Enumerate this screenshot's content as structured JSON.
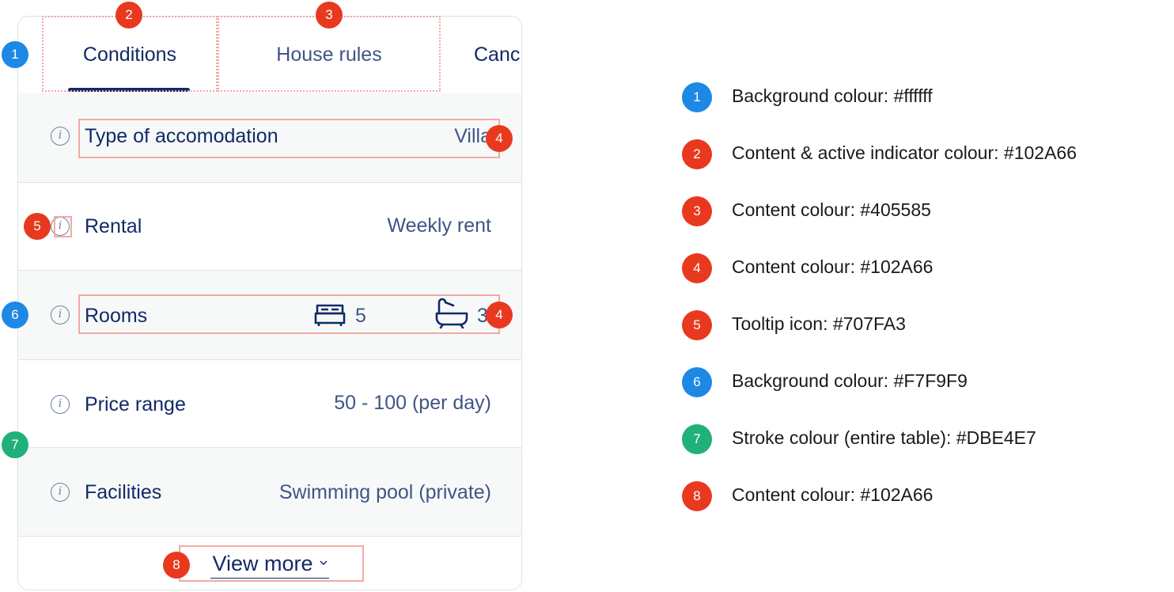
{
  "colors": {
    "blue": "#1E88E5",
    "red": "#E8391F",
    "green": "#20B07A",
    "content_dark": "#102A66",
    "content_mid": "#405585",
    "tooltip_icon": "#707FA3",
    "row_bg": "#F7F9F9",
    "stroke": "#DBE4E7"
  },
  "tabs": [
    {
      "label": "Conditions",
      "active": true
    },
    {
      "label": "House rules",
      "active": false
    },
    {
      "label": "Canc",
      "active": false
    }
  ],
  "rows": [
    {
      "label": "Type of accomodation",
      "value": "Villa",
      "info_icon": "info-icon"
    },
    {
      "label": "Rental",
      "value": "Weekly rent",
      "info_icon": "info-icon"
    },
    {
      "label": "Rooms",
      "bedrooms": "5",
      "bathrooms": "3",
      "bed_icon": "bed-icon",
      "bath_icon": "bathtub-icon"
    },
    {
      "label": "Price range",
      "value": "50 - 100 (per day)"
    },
    {
      "label": "Facilities",
      "value": "Swimming pool (private)"
    }
  ],
  "view_more": {
    "label": "View more",
    "icon": "chevron-down-icon"
  },
  "badges": [
    "1",
    "2",
    "3",
    "4",
    "4",
    "5",
    "6",
    "7",
    "8"
  ],
  "legend": [
    {
      "num": "1",
      "color": "blue",
      "text": "Background colour: #ffffff"
    },
    {
      "num": "2",
      "color": "red",
      "text": "Content & active indicator colour: #102A66"
    },
    {
      "num": "3",
      "color": "red",
      "text": "Content colour: #405585"
    },
    {
      "num": "4",
      "color": "red",
      "text": "Content colour: #102A66"
    },
    {
      "num": "5",
      "color": "red",
      "text": "Tooltip icon: #707FA3"
    },
    {
      "num": "6",
      "color": "blue",
      "text": "Background colour: #F7F9F9"
    },
    {
      "num": "7",
      "color": "green",
      "text": "Stroke colour (entire table): #DBE4E7"
    },
    {
      "num": "8",
      "color": "red",
      "text": "Content colour: #102A66"
    }
  ]
}
